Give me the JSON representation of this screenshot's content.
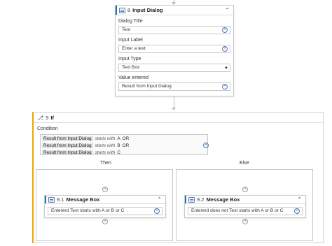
{
  "input_dialog": {
    "number": "8",
    "title": "Input Dialog",
    "dialog_title_label": "Dialog Title",
    "dialog_title_value": "Test",
    "input_label_label": "Input Label",
    "input_label_value": "Enter a text",
    "input_type_label": "Input Type",
    "input_type_value": "Text Box",
    "value_entered_label": "Value entered",
    "value_entered_value": "Result from Input Dialog"
  },
  "if_activity": {
    "number": "9",
    "title": "If",
    "condition_label": "Condition",
    "conditions": [
      {
        "variable": "Result from Input Dialog",
        "operator": "starts with",
        "value": "A",
        "conjunction": "OR"
      },
      {
        "variable": "Result from Input Dialog",
        "operator": "starts with",
        "value": "B",
        "conjunction": "OR"
      },
      {
        "variable": "Result from Input Dialog",
        "operator": "starts with",
        "value": "C",
        "conjunction": ""
      }
    ],
    "then_label": "Then",
    "else_label": "Else",
    "then_message": {
      "number": "9.1",
      "title": "Message Box",
      "text": "Entererd Text starts with A or B or C"
    },
    "else_message": {
      "number": "9.2",
      "title": "Message Box",
      "text": "Entererd does not Text starts with A or B or C"
    }
  },
  "icons": {
    "collapse": "chevron-up-icon",
    "add": "plus-circle-icon",
    "dropdown": "caret-down-icon",
    "if": "branch-icon",
    "activity": "dialog-icon"
  },
  "colors": {
    "accent_blue": "#1a73b8",
    "if_accent": "#f0a400",
    "plus_blue": "#4a78b5"
  }
}
